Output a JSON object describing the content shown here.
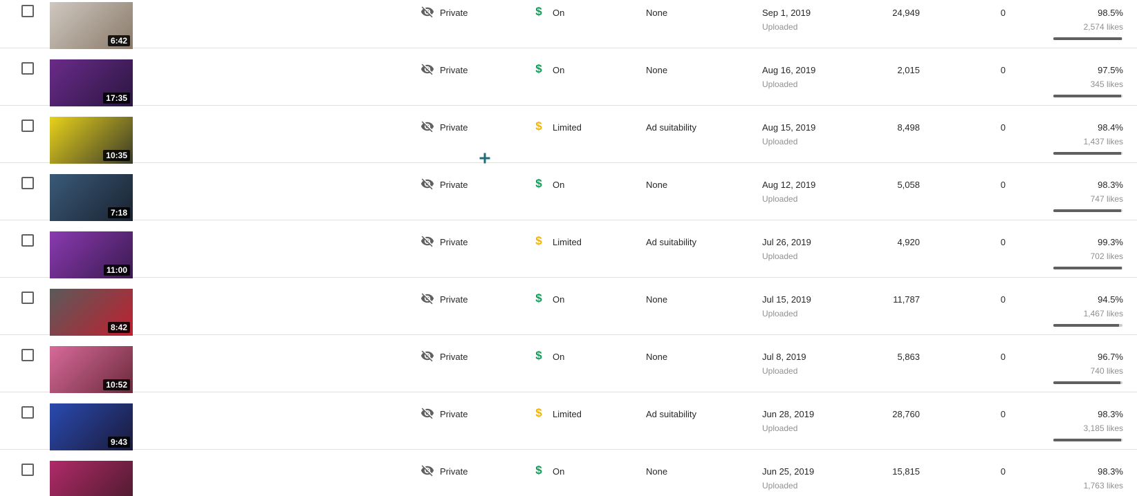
{
  "colors": {
    "monetization_on": "#0f9d58",
    "monetization_limited": "#f4b400",
    "divider": "#e0e0e0",
    "secondary_text": "#909090",
    "bar_track": "#cccccc",
    "bar_fill": "#606060"
  },
  "icons": {
    "visibility": "eye-off-icon",
    "monetization": "dollar-icon",
    "cursor": "crosshair-cursor-icon"
  },
  "rows": [
    {
      "duration": "6:42",
      "visibility": "Private",
      "monetization": "On",
      "monetization_status": "on",
      "restrictions": "None",
      "date": "Sep 1, 2019",
      "date_status": "Uploaded",
      "views": "24,949",
      "comments": "0",
      "like_percent": "98.5%",
      "like_fraction": 0.985,
      "likes": "2,574 likes",
      "thumb_colors": [
        "#cfc8c0",
        "#8a7a6a"
      ]
    },
    {
      "duration": "17:35",
      "visibility": "Private",
      "monetization": "On",
      "monetization_status": "on",
      "restrictions": "None",
      "date": "Aug 16, 2019",
      "date_status": "Uploaded",
      "views": "2,015",
      "comments": "0",
      "like_percent": "97.5%",
      "like_fraction": 0.975,
      "likes": "345 likes",
      "thumb_colors": [
        "#6a2b8a",
        "#2a1640"
      ]
    },
    {
      "duration": "10:35",
      "visibility": "Private",
      "monetization": "Limited",
      "monetization_status": "limited",
      "restrictions": "Ad suitability",
      "date": "Aug 15, 2019",
      "date_status": "Uploaded",
      "views": "8,498",
      "comments": "0",
      "like_percent": "98.4%",
      "like_fraction": 0.984,
      "likes": "1,437 likes",
      "thumb_colors": [
        "#e8d21a",
        "#3a3a2a"
      ]
    },
    {
      "duration": "7:18",
      "visibility": "Private",
      "monetization": "On",
      "monetization_status": "on",
      "restrictions": "None",
      "date": "Aug 12, 2019",
      "date_status": "Uploaded",
      "views": "5,058",
      "comments": "0",
      "like_percent": "98.3%",
      "like_fraction": 0.983,
      "likes": "747 likes",
      "thumb_colors": [
        "#3a5a78",
        "#1a2230"
      ]
    },
    {
      "duration": "11:00",
      "visibility": "Private",
      "monetization": "Limited",
      "monetization_status": "limited",
      "restrictions": "Ad suitability",
      "date": "Jul 26, 2019",
      "date_status": "Uploaded",
      "views": "4,920",
      "comments": "0",
      "like_percent": "99.3%",
      "like_fraction": 0.993,
      "likes": "702 likes",
      "thumb_colors": [
        "#8a3ab0",
        "#3a1a50"
      ]
    },
    {
      "duration": "8:42",
      "visibility": "Private",
      "monetization": "On",
      "monetization_status": "on",
      "restrictions": "None",
      "date": "Jul 15, 2019",
      "date_status": "Uploaded",
      "views": "11,787",
      "comments": "0",
      "like_percent": "94.5%",
      "like_fraction": 0.945,
      "likes": "1,467 likes",
      "thumb_colors": [
        "#5a5a5a",
        "#c02030"
      ]
    },
    {
      "duration": "10:52",
      "visibility": "Private",
      "monetization": "On",
      "monetization_status": "on",
      "restrictions": "None",
      "date": "Jul 8, 2019",
      "date_status": "Uploaded",
      "views": "5,863",
      "comments": "0",
      "like_percent": "96.7%",
      "like_fraction": 0.967,
      "likes": "740 likes",
      "thumb_colors": [
        "#d86a9a",
        "#6a2a3a"
      ]
    },
    {
      "duration": "9:43",
      "visibility": "Private",
      "monetization": "Limited",
      "monetization_status": "limited",
      "restrictions": "Ad suitability",
      "date": "Jun 28, 2019",
      "date_status": "Uploaded",
      "views": "28,760",
      "comments": "0",
      "like_percent": "98.3%",
      "like_fraction": 0.983,
      "likes": "3,185 likes",
      "thumb_colors": [
        "#2a4ab0",
        "#1a1a3a"
      ]
    },
    {
      "duration": "",
      "visibility": "Private",
      "monetization": "On",
      "monetization_status": "on",
      "restrictions": "None",
      "date": "Jun 25, 2019",
      "date_status": "Uploaded",
      "views": "15,815",
      "comments": "0",
      "like_percent": "98.3%",
      "like_fraction": 0.983,
      "likes": "1,763 likes",
      "thumb_colors": [
        "#b02a6a",
        "#4a1a2a"
      ]
    }
  ]
}
